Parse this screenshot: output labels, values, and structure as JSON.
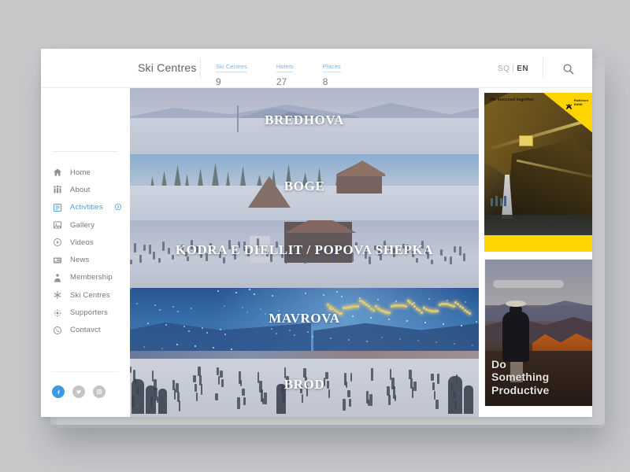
{
  "header": {
    "brand": "Ski Centres",
    "stats": [
      {
        "label": "Ski Centres",
        "value": "9"
      },
      {
        "label": "Hotels",
        "value": "27"
      },
      {
        "label": "Places",
        "value": "8"
      }
    ],
    "lang": {
      "inactive": "SQ",
      "separator": "|",
      "active": "EN"
    },
    "search_icon": "search-icon"
  },
  "sidebar": {
    "items": [
      {
        "label": "Home",
        "icon": "home-icon",
        "active": false
      },
      {
        "label": "About",
        "icon": "people-icon",
        "active": false
      },
      {
        "label": "Activtities",
        "icon": "list-icon",
        "active": true
      },
      {
        "label": "Gallery",
        "icon": "image-icon",
        "active": false
      },
      {
        "label": "Videos",
        "icon": "play-icon",
        "active": false
      },
      {
        "label": "News",
        "icon": "newspaper-icon",
        "active": false
      },
      {
        "label": "Membership",
        "icon": "badge-icon",
        "active": false
      },
      {
        "label": "Ski Centres",
        "icon": "snowflake-icon",
        "active": false
      },
      {
        "label": "Supporters",
        "icon": "hands-icon",
        "active": false
      },
      {
        "label": "Contavct",
        "icon": "phone-icon",
        "active": false
      }
    ],
    "active_marker_icon": "chevron-circle-right-icon",
    "socials": [
      {
        "name": "facebook",
        "glyph": "f",
        "color": "#3b9ae1"
      },
      {
        "name": "twitter",
        "glyph": "t",
        "color": "#c2c5c9"
      },
      {
        "name": "instagram",
        "glyph": "i",
        "color": "#c2c5c9"
      }
    ]
  },
  "main": {
    "banners": [
      {
        "title": "BREDHOVA"
      },
      {
        "title": "BOGE"
      },
      {
        "title": "KODRA E DIELLIT / POPOVA SHEPKA"
      },
      {
        "title": "MAVROVA"
      },
      {
        "title": "BROD"
      }
    ]
  },
  "ads": [
    {
      "name": "raiffeisen-bank-ad",
      "logo_text": "Raiffeisen BANK",
      "tagline": "We succeed together.",
      "accent_color": "#ffd400"
    },
    {
      "name": "do-something-productive-ad",
      "line1": "Do",
      "line2": "Something",
      "line3": "Productive"
    }
  ]
}
